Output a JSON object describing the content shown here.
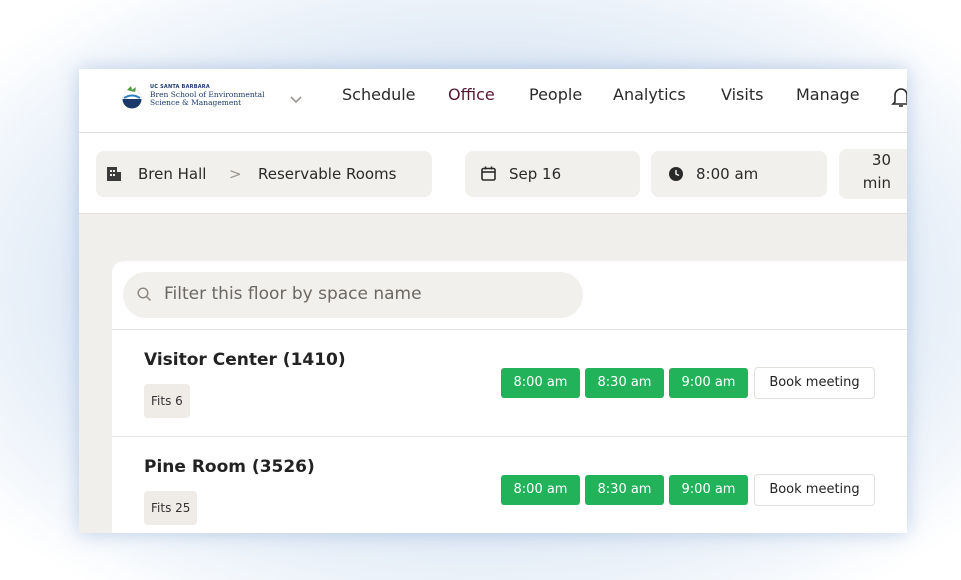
{
  "brand": {
    "line1": "UC SANTA BARBARA",
    "line2": "Bren School of Environmental",
    "line3": "Science & Management"
  },
  "nav": {
    "items": [
      {
        "label": "Schedule",
        "active": false
      },
      {
        "label": "Office",
        "active": true
      },
      {
        "label": "People",
        "active": false
      },
      {
        "label": "Analytics",
        "active": false
      },
      {
        "label": "Visits",
        "active": false
      },
      {
        "label": "Manage",
        "active": false
      }
    ]
  },
  "location": {
    "building": "Bren Hall",
    "separator": ">",
    "area": "Reservable Rooms"
  },
  "date": "Sep 16",
  "time": "8:00 am",
  "duration": {
    "value": "30",
    "unit": "min"
  },
  "filter": {
    "placeholder": "Filter this floor by space name"
  },
  "rooms": [
    {
      "name": "Visitor Center (1410)",
      "capacity": "Fits 6",
      "slots": [
        "8:00 am",
        "8:30 am",
        "9:00 am"
      ],
      "action": "Book meeting"
    },
    {
      "name": "Pine Room (3526)",
      "capacity": "Fits 25",
      "slots": [
        "8:00 am",
        "8:30 am",
        "9:00 am"
      ],
      "action": "Book meeting"
    }
  ],
  "colors": {
    "active_nav": "#5a1535",
    "slot_green": "#22b35a",
    "background": "#f1efec"
  }
}
